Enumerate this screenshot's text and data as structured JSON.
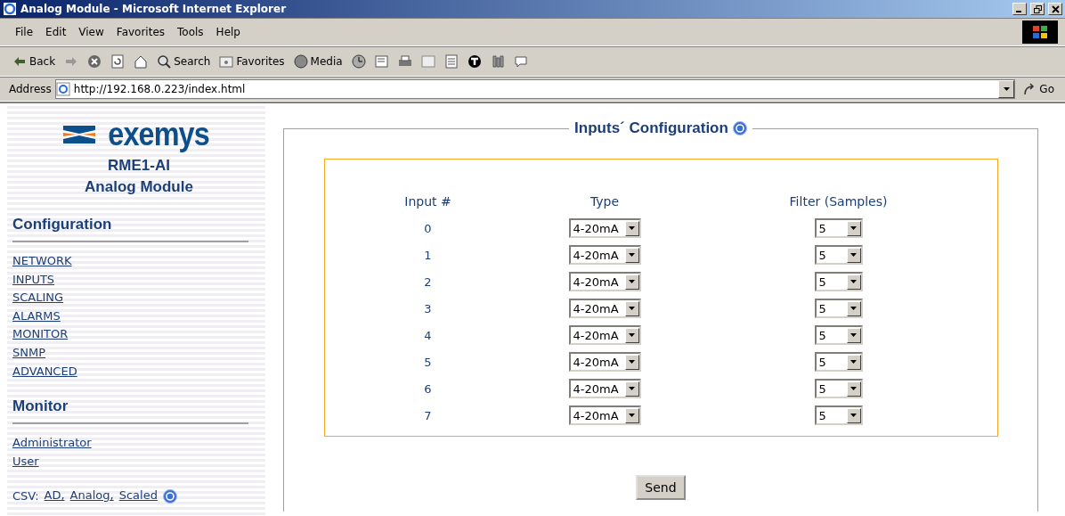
{
  "window": {
    "title": "Analog Module - Microsoft Internet Explorer"
  },
  "menu": [
    "File",
    "Edit",
    "View",
    "Favorites",
    "Tools",
    "Help"
  ],
  "toolbar": [
    {
      "kind": "back",
      "label": "Back"
    },
    {
      "kind": "forward"
    },
    {
      "kind": "stop"
    },
    {
      "kind": "refresh"
    },
    {
      "kind": "home"
    },
    {
      "kind": "search",
      "label": "Search"
    },
    {
      "kind": "favorites",
      "label": "Favorites"
    },
    {
      "kind": "media",
      "label": "Media"
    },
    {
      "kind": "history"
    },
    {
      "kind": "mail"
    },
    {
      "kind": "print"
    },
    {
      "kind": "edit"
    },
    {
      "kind": "discuss"
    },
    {
      "kind": "messenger"
    },
    {
      "kind": "research"
    },
    {
      "kind": "chat"
    }
  ],
  "address": {
    "label": "Address",
    "value": "http://192.168.0.223/index.html",
    "go": "Go"
  },
  "sidebar": {
    "logo": "exemys",
    "model": "RME1-AI",
    "subtitle": "Analog Module",
    "sections": [
      {
        "title": "Configuration",
        "links": [
          "NETWORK",
          "INPUTS",
          "SCALING",
          "ALARMS",
          "MONITOR",
          "SNMP",
          "ADVANCED"
        ]
      },
      {
        "title": "Monitor",
        "links": [
          "Administrator",
          "User"
        ]
      }
    ],
    "csv": {
      "label": "CSV:",
      "links": [
        "AD,",
        "Analog,",
        "Scaled"
      ]
    }
  },
  "form": {
    "title": "Inputs´ Configuration",
    "columns": [
      "Input #",
      "Type",
      "Filter (Samples)"
    ],
    "rows": [
      {
        "input": "0",
        "type": "4-20mA",
        "filter": "5"
      },
      {
        "input": "1",
        "type": "4-20mA",
        "filter": "5"
      },
      {
        "input": "2",
        "type": "4-20mA",
        "filter": "5"
      },
      {
        "input": "3",
        "type": "4-20mA",
        "filter": "5"
      },
      {
        "input": "4",
        "type": "4-20mA",
        "filter": "5"
      },
      {
        "input": "5",
        "type": "4-20mA",
        "filter": "5"
      },
      {
        "input": "6",
        "type": "4-20mA",
        "filter": "5"
      },
      {
        "input": "7",
        "type": "4-20mA",
        "filter": "5"
      }
    ],
    "button": "Send"
  }
}
